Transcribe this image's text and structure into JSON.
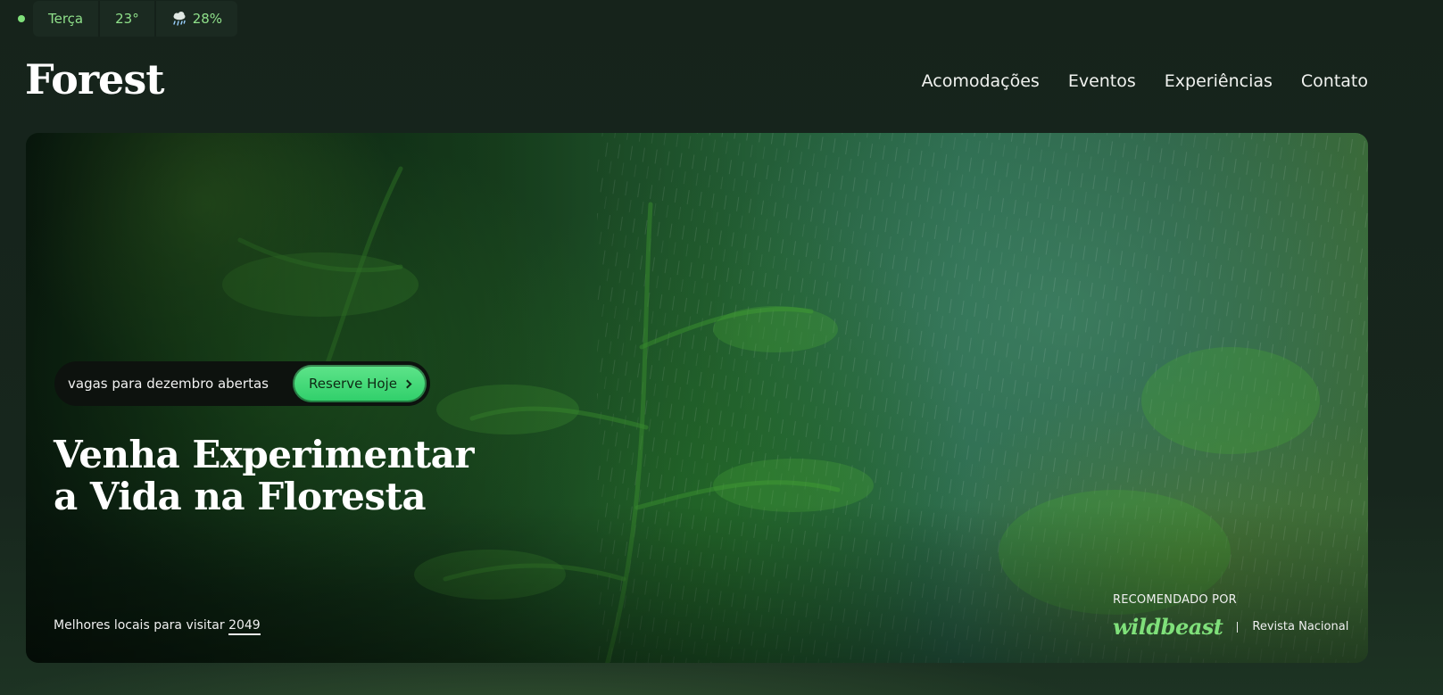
{
  "status": {
    "day": "Terça",
    "temperature": "23°",
    "rain_chance": "28%",
    "rain_icon": "rain-cloud-icon"
  },
  "header": {
    "logo": "Forest",
    "nav": [
      "Acomodações",
      "Eventos",
      "Experiências",
      "Contato"
    ]
  },
  "hero": {
    "cta_text": "vagas para dezembro abertas",
    "cta_button": "Reserve Hoje",
    "title_line1": "Venha Experimentar",
    "title_line2": "a Vida na Floresta",
    "best_places_label": "Melhores locais para visitar",
    "best_places_year": "2049",
    "recommended_label": "RECOMENDADO POR",
    "recommended_brand": "wildbeast",
    "recommended_magazine": "Revista Nacional"
  },
  "colors": {
    "background": "#16241c",
    "accent": "#7fe07a",
    "cta": "#3bd672"
  }
}
